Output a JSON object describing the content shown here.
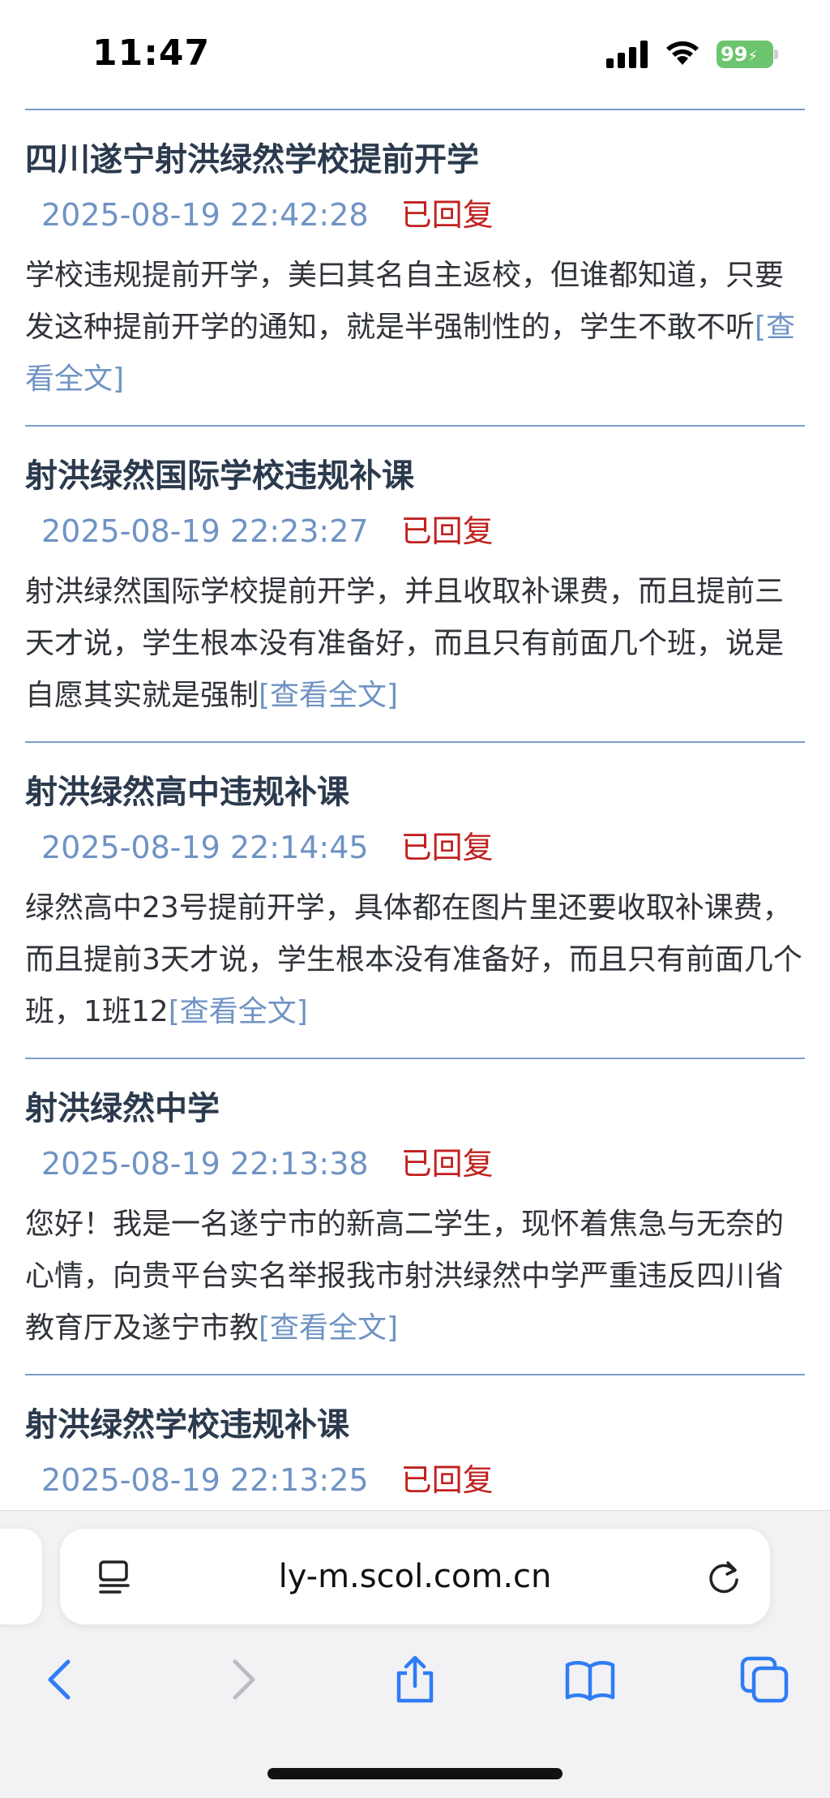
{
  "status_bar": {
    "time": "11:47",
    "battery": "99"
  },
  "posts": [
    {
      "title": "四川遂宁射洪绿然学校提前开学",
      "date": "2025-08-19 22:42:28",
      "status": "已回复",
      "excerpt": "学校违规提前开学，美曰其名自主返校，但谁都知道，只要发这种提前开学的通知，就是半强制性的，学生不敢不听",
      "read_more": "[查看全文]"
    },
    {
      "title": "射洪绿然国际学校违规补课",
      "date": "2025-08-19 22:23:27",
      "status": "已回复",
      "excerpt": "射洪绿然国际学校提前开学，并且收取补课费，而且提前三天才说，学生根本没有准备好，而且只有前面几个班，说是自愿其实就是强制",
      "read_more": "[查看全文]"
    },
    {
      "title": "射洪绿然高中违规补课",
      "date": "2025-08-19 22:14:45",
      "status": "已回复",
      "excerpt": "绿然高中23号提前开学，具体都在图片里还要收取补课费，而且提前3天才说，学生根本没有准备好，而且只有前面几个班，1班12",
      "read_more": "[查看全文]"
    },
    {
      "title": "射洪绿然中学",
      "date": "2025-08-19 22:13:38",
      "status": "已回复",
      "excerpt": "您好！我是一名遂宁市的新高二学生，现怀着焦急与无奈的心情，向贵平台实名举报我市射洪绿然中学严重违反四川省教育厅及遂宁市教",
      "read_more": "[查看全文]"
    },
    {
      "title": "射洪绿然学校违规补课",
      "date": "2025-08-19 22:13:25",
      "status": "已回复"
    }
  ],
  "browser": {
    "url": "ly-m.scol.com.cn"
  },
  "colors": {
    "divider": "#7f9bc9",
    "date": "#6f93c4",
    "status": "#c0211f",
    "link": "#6f93c4"
  }
}
